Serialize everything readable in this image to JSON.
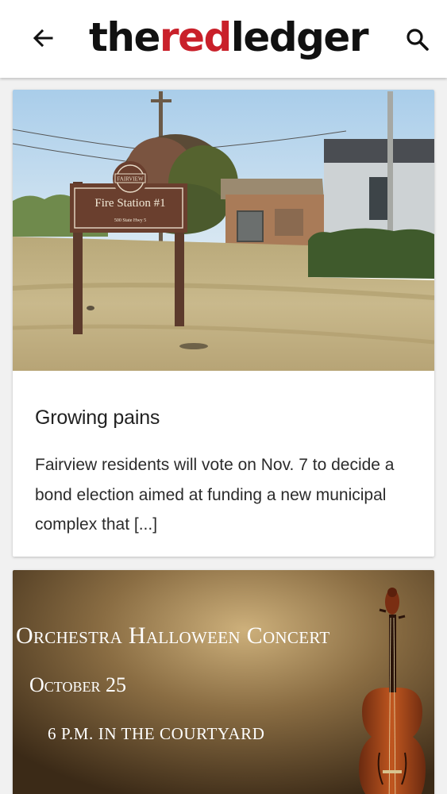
{
  "header": {
    "logo_prefix": "the",
    "logo_highlight": "red",
    "logo_suffix": "ledger",
    "back_icon": "arrow-left-icon",
    "search_icon": "search-icon",
    "brand_color": "#c9202a"
  },
  "feed": {
    "articles": [
      {
        "image_sign_badge": "FAIRVIEW",
        "image_sign_title": "Fire Station #1",
        "image_sign_address": "500 State Hwy 5",
        "title": "Growing pains",
        "excerpt": "Fairview residents will vote on Nov. 7 to decide a bond election aimed at funding a new municipal complex that [...]"
      }
    ],
    "promo": {
      "title": "Orchestra Halloween Concert",
      "date": "October 25",
      "time": "6 P.M. IN THE COURTYARD"
    }
  }
}
